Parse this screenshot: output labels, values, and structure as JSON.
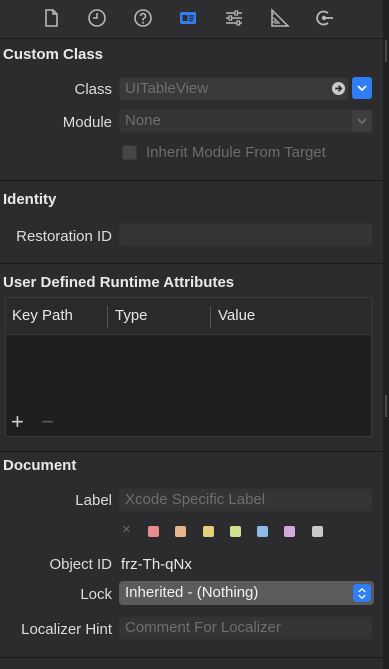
{
  "toolbar": {
    "icons": [
      "file-inspector-icon",
      "history-inspector-icon",
      "quick-help-icon",
      "identity-inspector-icon",
      "attributes-inspector-icon",
      "size-inspector-icon",
      "connections-inspector-icon"
    ],
    "selected": "identity-inspector-icon",
    "accent": "#2f7ef5"
  },
  "custom_class": {
    "title": "Custom Class",
    "class_label": "Class",
    "class_value": "UITableView",
    "module_label": "Module",
    "module_value": "None",
    "inherit_label": "Inherit Module From Target",
    "inherit_checked": false
  },
  "identity": {
    "title": "Identity",
    "restoration_label": "Restoration ID",
    "restoration_value": ""
  },
  "runtime_attributes": {
    "title": "User Defined Runtime Attributes",
    "columns": [
      "Key Path",
      "Type",
      "Value"
    ],
    "rows": [],
    "add_symbol": "+",
    "remove_symbol": "−"
  },
  "document": {
    "title": "Document",
    "label_label": "Label",
    "label_placeholder": "Xcode Specific Label",
    "clear_symbol": "×",
    "color_swatches": [
      "#e88c8c",
      "#e8b48a",
      "#e3d27a",
      "#cfe18f",
      "#8fb9e8",
      "#d5a8e0",
      "#c9c9c9"
    ],
    "object_id_label": "Object ID",
    "object_id_value": "frz-Th-qNx",
    "lock_label": "Lock",
    "lock_value": "Inherited - (Nothing)",
    "localizer_label": "Localizer Hint",
    "localizer_placeholder": "Comment For Localizer"
  }
}
